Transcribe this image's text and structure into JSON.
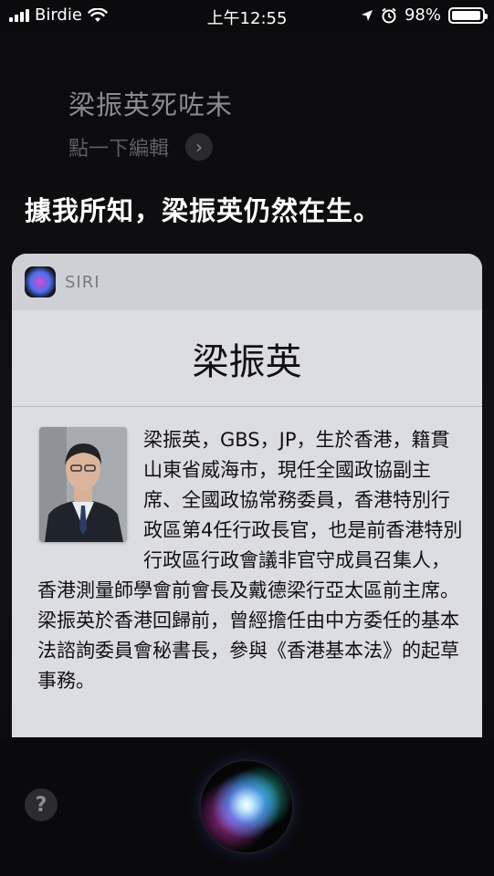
{
  "status_bar": {
    "carrier": "Birdie",
    "time": "上午12:55",
    "battery": "98%",
    "battery_level": 0.98
  },
  "siri": {
    "query": "梁振英死咗未",
    "edit_hint": "點一下編輯",
    "answer": "據我所知，梁振英仍然在生。"
  },
  "card": {
    "app_name": "SIRI",
    "title": "梁振英",
    "description": "梁振英，GBS，JP，生於香港，籍貫山東省威海市，現任全國政協副主席、全國政協常務委員，香港特別行政區第4任行政長官，也是前香港特別行政區行政會議非官守成員召集人，香港測量師學會前會長及戴德梁行亞太區前主席。梁振英於香港回歸前，曾經擔任由中方委任的基本法諮詢委員會秘書長，參與《香港基本法》的起草事務。"
  },
  "icons": {
    "help": "?",
    "chevron": "›"
  }
}
